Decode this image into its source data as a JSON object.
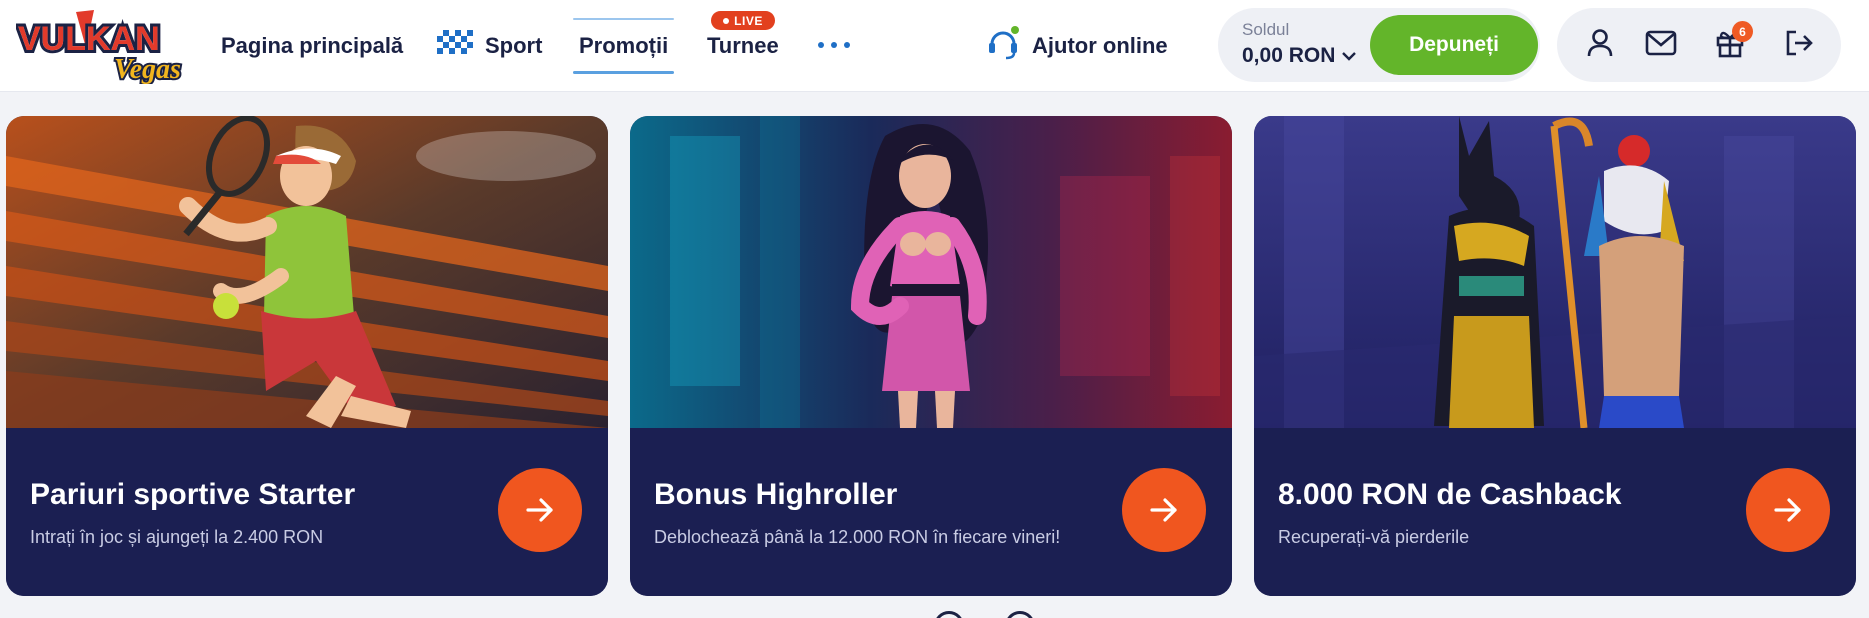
{
  "brand": {
    "logo_word_1": "VULKAN",
    "logo_word_2": "Vegas"
  },
  "nav": {
    "items": [
      {
        "label": "Pagina principală"
      },
      {
        "label": "Sport"
      },
      {
        "label": "Promoții"
      },
      {
        "label": "Turnee"
      }
    ],
    "active": "Promoții",
    "live_badge": "LIVE",
    "more_icon": "more-dots-icon"
  },
  "help": {
    "label": "Ajutor online",
    "icon": "headset-icon"
  },
  "account": {
    "balance_label": "Soldul",
    "balance_value": "0,00 RON",
    "deposit_label": "Depuneți",
    "gift_count": "6",
    "icons": [
      "user-icon",
      "mail-icon",
      "gift-icon",
      "logout-icon"
    ]
  },
  "promos": [
    {
      "title": "Pariuri sportive Starter",
      "subtitle": "Intrați în joc și ajungeți la 2.400 RON"
    },
    {
      "title": "Bonus Highroller",
      "subtitle": "Deblochează până la 12.000 RON în fiecare vineri!"
    },
    {
      "title": "8.000 RON de Cashback",
      "subtitle": "Recuperați-vă pierderile"
    }
  ],
  "colors": {
    "accent_green": "#63b52a",
    "accent_orange": "#f0561f",
    "card_navy": "#1b1f52",
    "live_red": "#e2401e",
    "brand_blue": "#1f6fc6"
  }
}
